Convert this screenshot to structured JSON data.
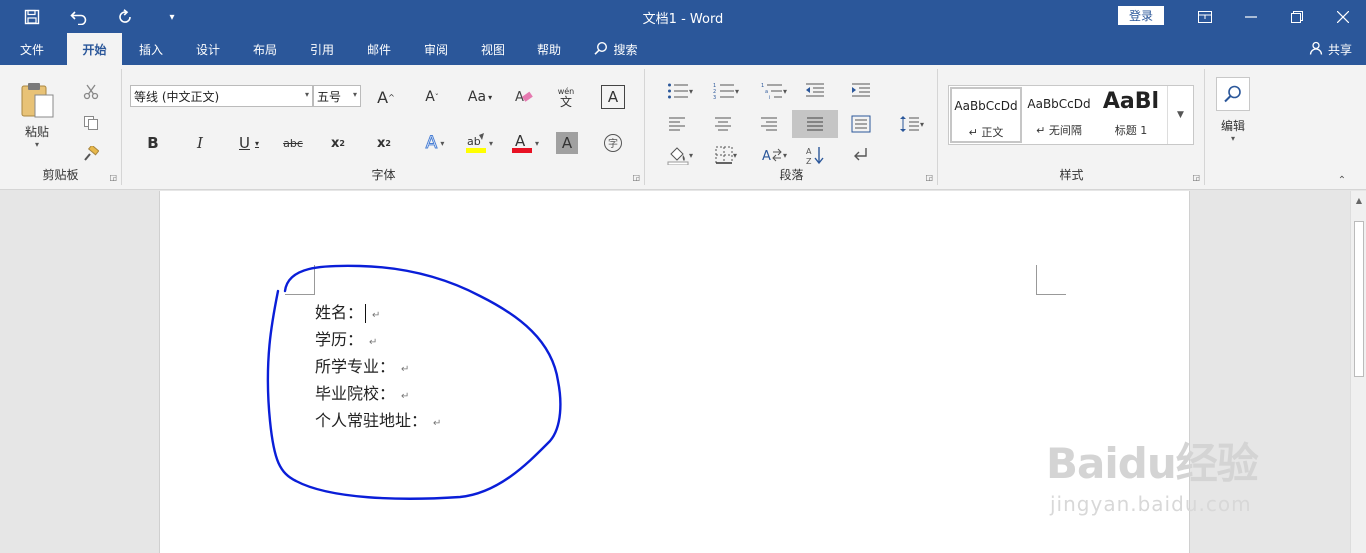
{
  "titlebar": {
    "doc_title": "文档1  -  Word",
    "login_label": "登录"
  },
  "menu": {
    "tabs": [
      {
        "label": "文件"
      },
      {
        "label": "开始"
      },
      {
        "label": "插入"
      },
      {
        "label": "设计"
      },
      {
        "label": "布局"
      },
      {
        "label": "引用"
      },
      {
        "label": "邮件"
      },
      {
        "label": "审阅"
      },
      {
        "label": "视图"
      },
      {
        "label": "帮助"
      },
      {
        "label": "搜索"
      }
    ],
    "active_tab": "开始",
    "share_label": "共享"
  },
  "ribbon": {
    "clipboard": {
      "paste_label": "粘贴",
      "group_label": "剪贴板"
    },
    "font": {
      "font_name": "等线 (中文正文)",
      "font_size": "五号",
      "change_case_label": "Aa",
      "phonetic_label": "wén",
      "group_label": "字体",
      "highlight_color": "#ffff00",
      "font_color": "#e81123"
    },
    "paragraph": {
      "group_label": "段落"
    },
    "styles": {
      "items": [
        {
          "sample": "AaBbCcDd",
          "name": "↵ 正文"
        },
        {
          "sample": "AaBbCcDd",
          "name": "↵ 无间隔"
        },
        {
          "sample": "AaBl",
          "name": "标题 1"
        }
      ],
      "group_label": "样式"
    },
    "editing": {
      "label": "编辑"
    }
  },
  "document": {
    "lines": [
      {
        "text": "姓名："
      },
      {
        "text": "学历："
      },
      {
        "text": "所学专业："
      },
      {
        "text": "毕业院校："
      },
      {
        "text": "个人常驻地址："
      }
    ],
    "paragraph_mark": "↵",
    "ink_color": "#0a1ed8"
  },
  "watermark": {
    "logo": "Baidu经验",
    "url": "jingyan.baidu.com"
  },
  "colors": {
    "brand": "#2b579a",
    "ribbon_bg": "#f3f3f3"
  }
}
